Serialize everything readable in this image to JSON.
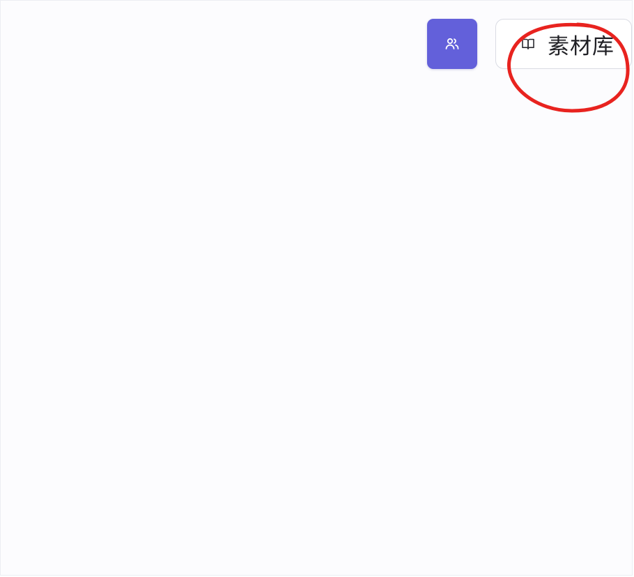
{
  "toolbar": {
    "users_button": {
      "icon": "users-icon",
      "color": "#6360da"
    },
    "library_button": {
      "icon": "book-open-icon",
      "label": "素材库"
    }
  },
  "annotation": {
    "shape": "ellipse",
    "color": "#e8231f"
  }
}
